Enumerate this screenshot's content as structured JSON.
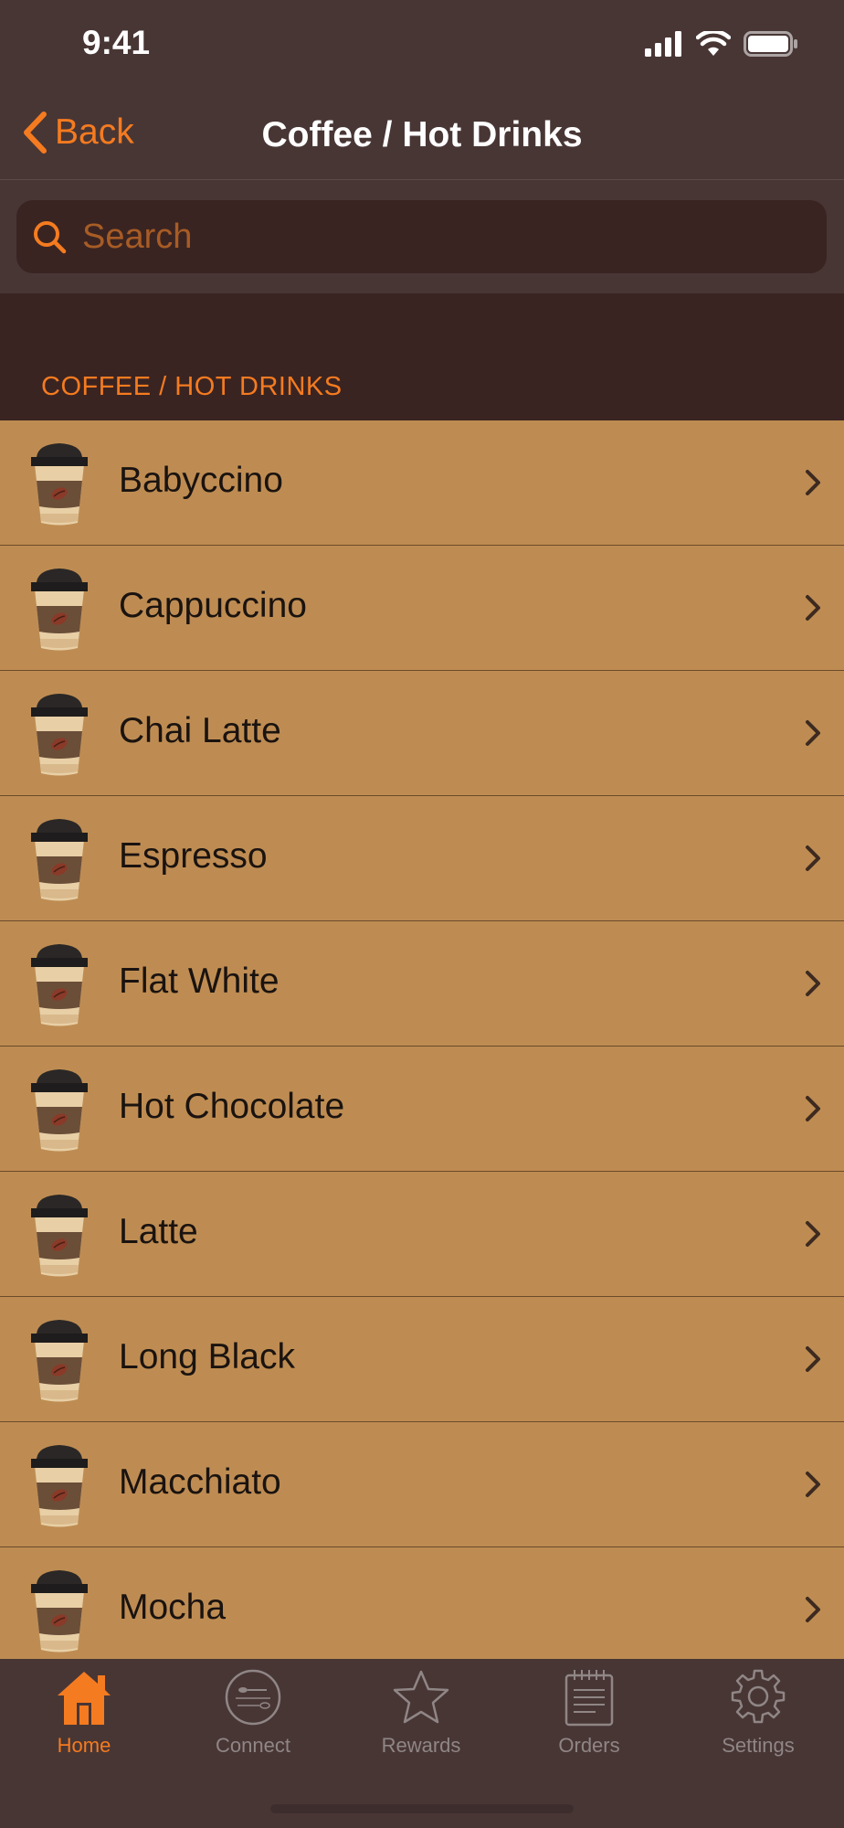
{
  "status": {
    "time": "9:41"
  },
  "nav": {
    "back_label": "Back",
    "title": "Coffee / Hot Drinks"
  },
  "search": {
    "placeholder": "Search"
  },
  "section": {
    "header": "COFFEE / HOT DRINKS"
  },
  "items": [
    {
      "label": "Babyccino"
    },
    {
      "label": "Cappuccino"
    },
    {
      "label": "Chai Latte"
    },
    {
      "label": "Espresso"
    },
    {
      "label": "Flat White"
    },
    {
      "label": "Hot Chocolate"
    },
    {
      "label": "Latte"
    },
    {
      "label": "Long Black"
    },
    {
      "label": "Macchiato"
    },
    {
      "label": "Mocha"
    }
  ],
  "tabs": [
    {
      "label": "Home",
      "icon": "home-icon",
      "active": true
    },
    {
      "label": "Connect",
      "icon": "connect-icon",
      "active": false
    },
    {
      "label": "Rewards",
      "icon": "star-icon",
      "active": false
    },
    {
      "label": "Orders",
      "icon": "notepad-icon",
      "active": false
    },
    {
      "label": "Settings",
      "icon": "gear-icon",
      "active": false
    }
  ],
  "colors": {
    "accent": "#f57b20",
    "background": "#483635",
    "row_background": "#be8c52",
    "section_background": "#3a2422"
  }
}
